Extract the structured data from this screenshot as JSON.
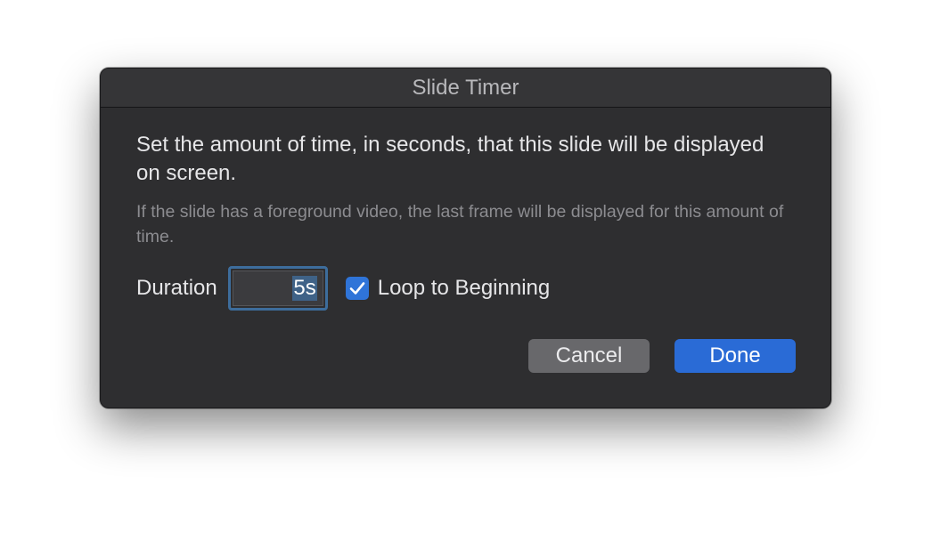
{
  "dialog": {
    "title": "Slide Timer",
    "message": "Set the amount of time, in seconds, that this slide will be displayed on screen.",
    "note": "If the slide has a foreground video, the last frame will be displayed for this amount of time."
  },
  "duration": {
    "label": "Duration",
    "value": "5s"
  },
  "loop": {
    "label": "Loop to Beginning",
    "checked": true,
    "icon": "checkmark-icon"
  },
  "buttons": {
    "cancel": "Cancel",
    "done": "Done"
  },
  "colors": {
    "accent": "#2a6bd6",
    "dialog_bg": "#2e2e30"
  }
}
